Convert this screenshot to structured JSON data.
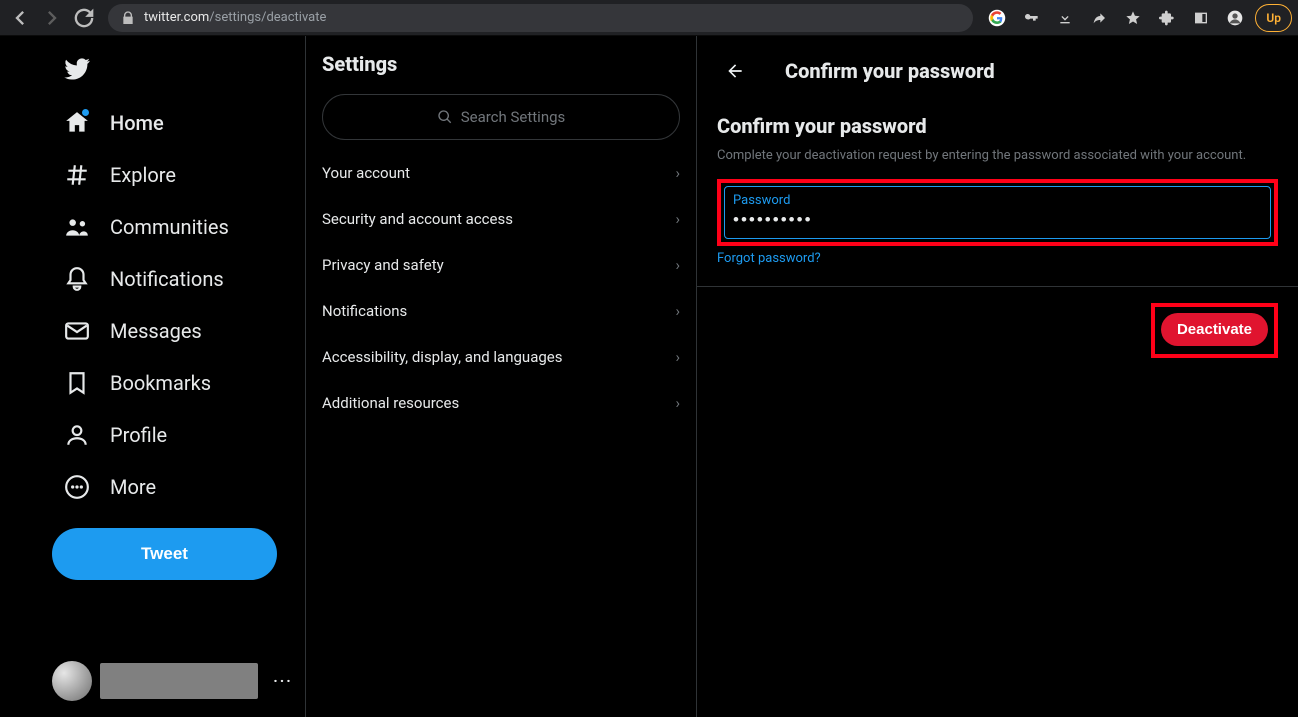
{
  "browser": {
    "host": "twitter.com",
    "path": "/settings/deactivate",
    "upgrade_label": "Up"
  },
  "nav": {
    "items": [
      {
        "label": "Home"
      },
      {
        "label": "Explore"
      },
      {
        "label": "Communities"
      },
      {
        "label": "Notifications"
      },
      {
        "label": "Messages"
      },
      {
        "label": "Bookmarks"
      },
      {
        "label": "Profile"
      },
      {
        "label": "More"
      }
    ],
    "tweet_label": "Tweet"
  },
  "settings": {
    "title": "Settings",
    "search_placeholder": "Search Settings",
    "items": [
      {
        "label": "Your account"
      },
      {
        "label": "Security and account access"
      },
      {
        "label": "Privacy and safety"
      },
      {
        "label": "Notifications"
      },
      {
        "label": "Accessibility, display, and languages"
      },
      {
        "label": "Additional resources"
      }
    ]
  },
  "detail": {
    "header_title": "Confirm your password",
    "section_title": "Confirm your password",
    "section_desc": "Complete your deactivation request by entering the password associated with your account.",
    "password_label": "Password",
    "password_value": "••••••••••",
    "forgot_label": "Forgot password?",
    "deactivate_label": "Deactivate"
  }
}
